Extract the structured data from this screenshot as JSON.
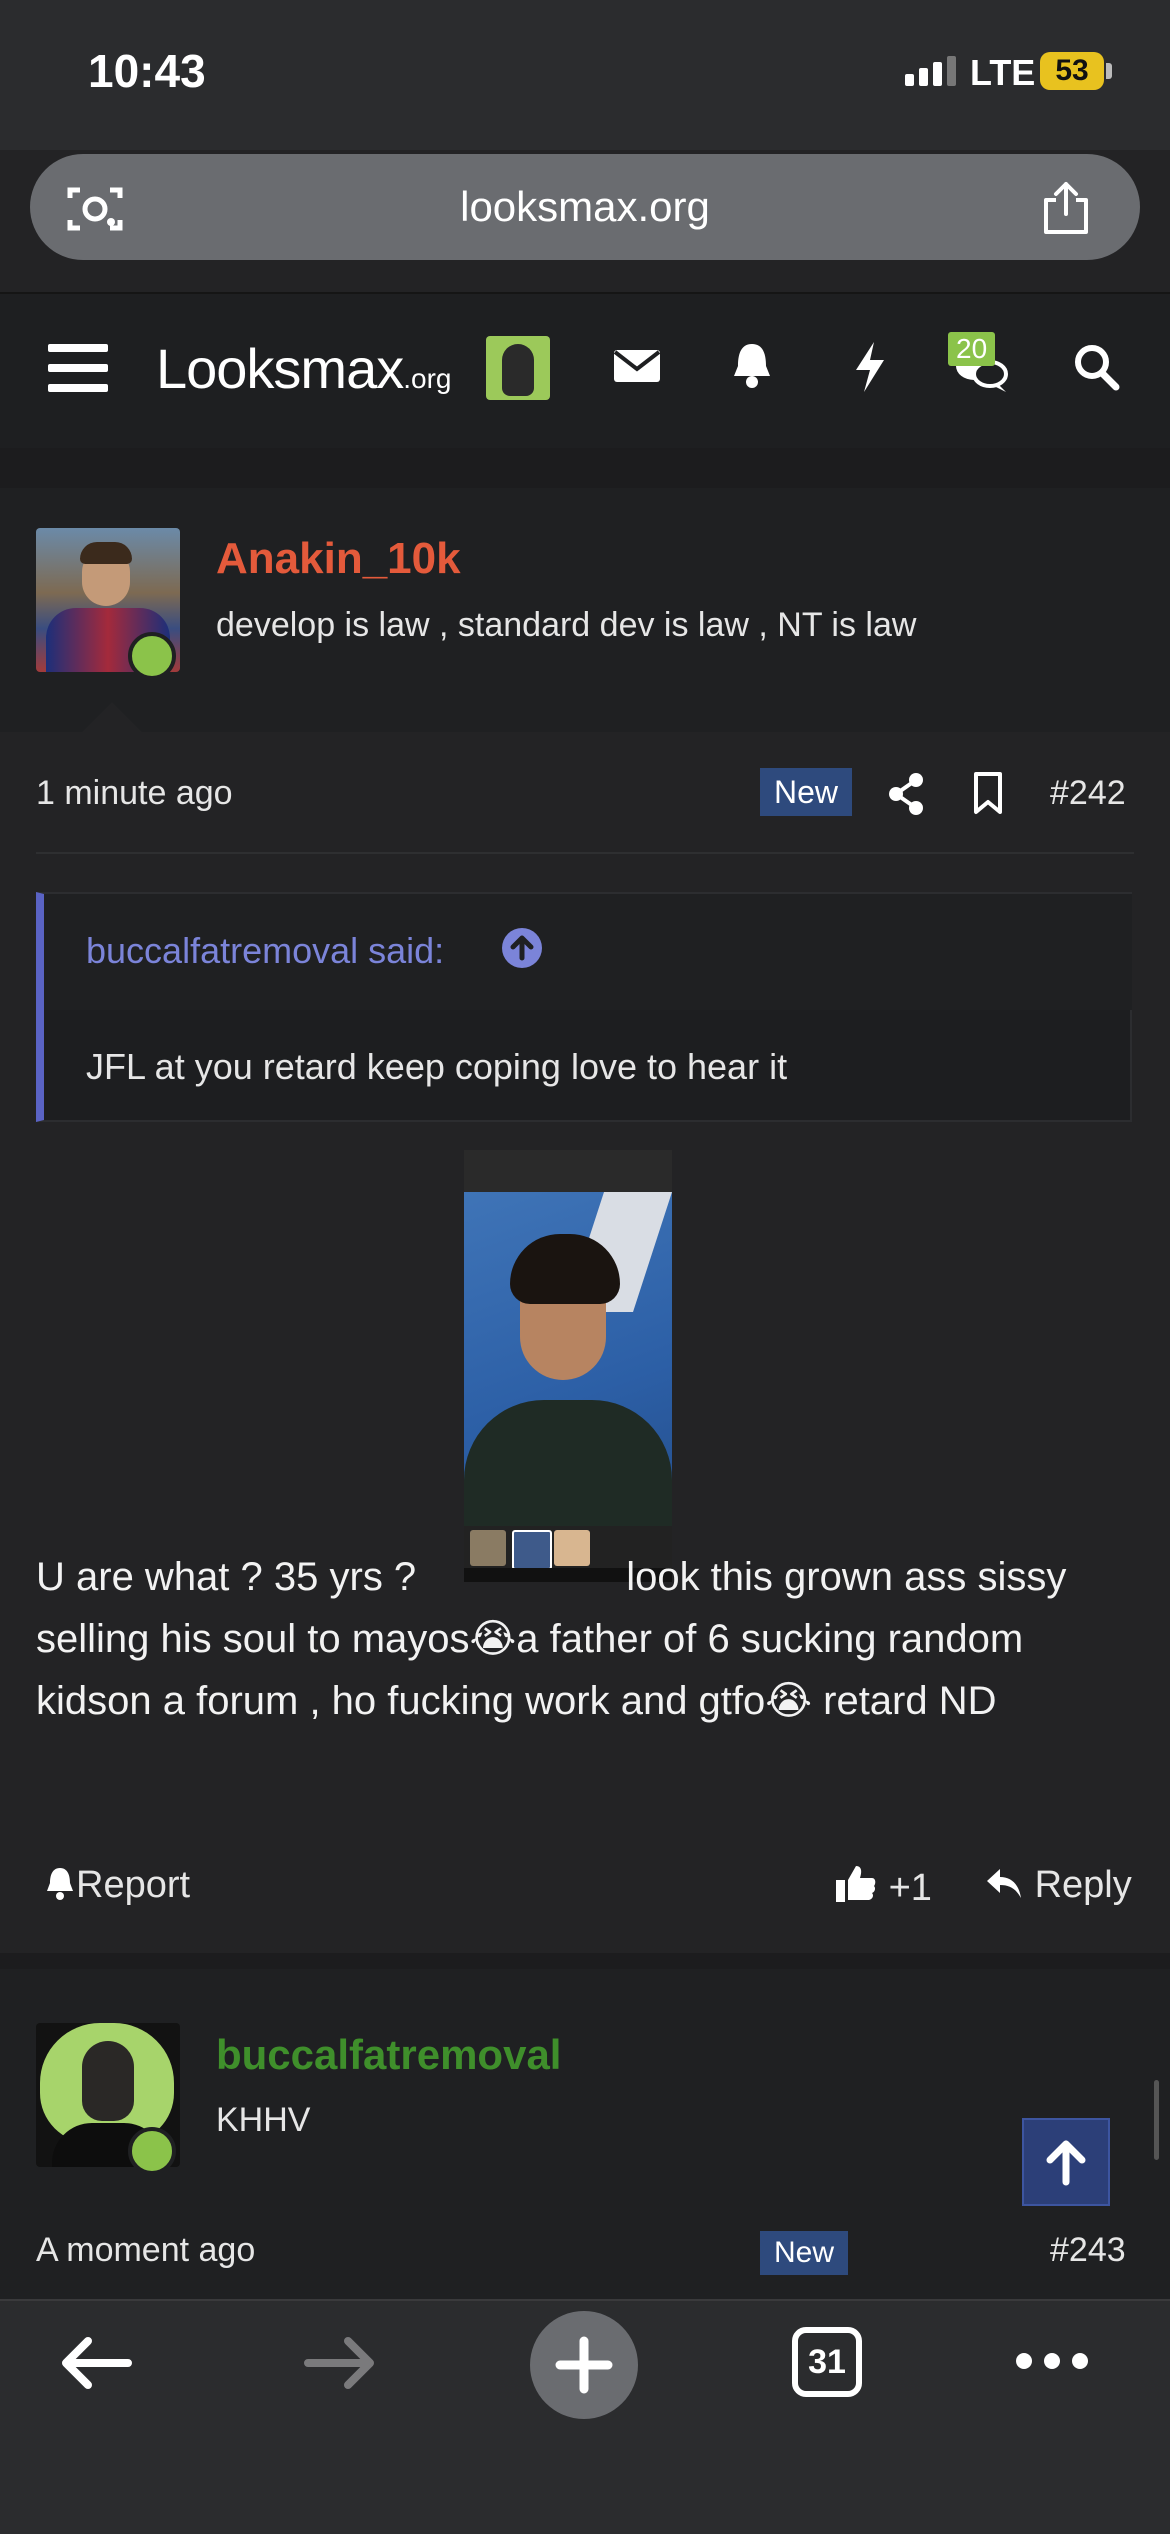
{
  "status_bar": {
    "time": "10:43",
    "network": "LTE",
    "battery": "53"
  },
  "address_bar": {
    "url": "looksmax.org"
  },
  "forum_header": {
    "logo_text": "Looksmax",
    "logo_suffix": ".org",
    "conversations_badge": "20"
  },
  "post": {
    "author": "Anakin_10k",
    "author_title": "develop is law , standard dev is law , NT is law",
    "timestamp": "1 minute ago",
    "new_badge": "New",
    "post_number": "#242",
    "quote": {
      "author": "buccalfatremoval said:",
      "text": "JFL at you retard keep coping love to hear it"
    },
    "body_part1": "U are what ? 35 yrs ?",
    "body_part2": "look this grown ass sissy selling his soul to mayos😭a father of 6 sucking random kidson a forum , ho fucking work and gtfo😭 retard ND",
    "actions": {
      "report": "Report",
      "likes": "+1",
      "reply": "Reply"
    }
  },
  "next_post": {
    "author": "buccalfatremoval",
    "author_title": "KHHV",
    "timestamp": "A moment ago",
    "new_badge": "New",
    "post_number": "#243"
  },
  "toolbar": {
    "tabs_count": "31"
  },
  "colors": {
    "background": "#232325",
    "author_red": "#e45a3b",
    "author_green": "#3f8f2b",
    "quote_accent": "#5a63c4",
    "new_badge": "#2e4a7d",
    "online": "#8bc34a"
  }
}
